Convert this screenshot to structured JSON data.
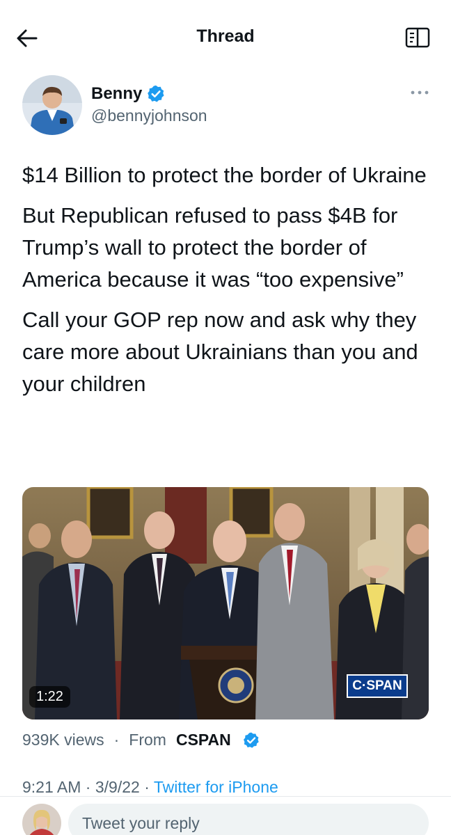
{
  "header": {
    "title": "Thread",
    "back_icon": "arrow-left-icon",
    "reader_icon": "reader-mode-icon"
  },
  "author": {
    "name": "Benny",
    "handle": "@bennyjohnson",
    "verified": true,
    "verified_color": "#1d9bf0"
  },
  "tweet": {
    "paragraphs": [
      "$14 Billion to protect the border of Ukraine",
      "But Republican refused to pass $4B for Trump’s wall to protect the border of America because it was “too expensive”",
      "Call your GOP rep now and ask why they care more about Ukrainians than you and your children"
    ]
  },
  "media": {
    "duration": "1:22",
    "watermark": "C·SPAN",
    "kind": "video"
  },
  "stats": {
    "views": "939K views",
    "separator": "·",
    "from_label": "From",
    "from_name": "CSPAN"
  },
  "timestamp": {
    "time": "9:21 AM",
    "date": "3/9/22",
    "source": "Twitter for iPhone"
  },
  "reply": {
    "placeholder": "Tweet your reply"
  },
  "colors": {
    "accent": "#1d9bf0",
    "secondary_text": "#536471",
    "primary_text": "#0f1419"
  }
}
